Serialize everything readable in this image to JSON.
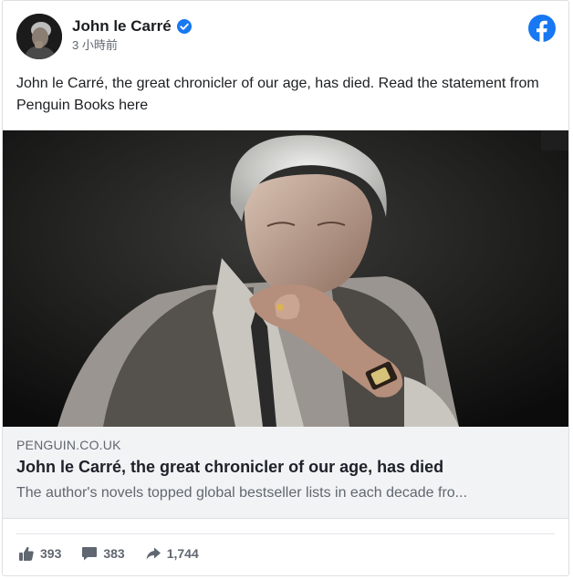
{
  "post": {
    "author_name": "John le Carré",
    "timestamp": "3 小時前",
    "text": "John le Carré, the great chronicler of our age, has died. Read the statement from Penguin Books here"
  },
  "link_preview": {
    "domain": "PENGUIN.CO.UK",
    "title": "John le Carré, the great chronicler of our age, has died",
    "description": "The author's novels topped global bestseller lists in each decade fro..."
  },
  "engagement": {
    "likes": "393",
    "comments": "383",
    "shares": "1,744"
  },
  "icons": {
    "verified": "verified-badge-icon",
    "platform": "facebook-logo-icon",
    "like": "thumbs-up-icon",
    "comment": "speech-bubble-icon",
    "share": "share-arrow-icon"
  },
  "colors": {
    "facebook_blue": "#1877f2",
    "secondary_text": "#606770",
    "link_box_bg": "#f2f3f5"
  }
}
